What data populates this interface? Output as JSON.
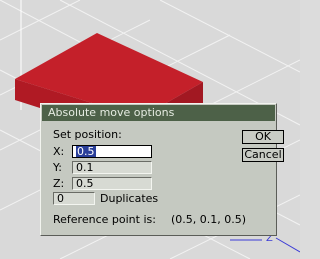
{
  "dialog": {
    "title": "Absolute move options",
    "set_position_label": "Set position:",
    "x_label": "X:",
    "x_value": "0.5",
    "y_label": "Y:",
    "y_value": "0.1",
    "z_label": "Z:",
    "z_value": "0.5",
    "duplicates_value": "0",
    "duplicates_label": "Duplicates",
    "reference_label": "Reference point is:",
    "reference_value": "(0.5, 0.1, 0.5)",
    "ok_label": "OK",
    "cancel_label": "Cancel"
  },
  "viewport": {
    "axis_label": "Z",
    "object_color": "#c4202a",
    "background_color": "#d9d9d9",
    "grid_color": "#f0f0f0"
  }
}
